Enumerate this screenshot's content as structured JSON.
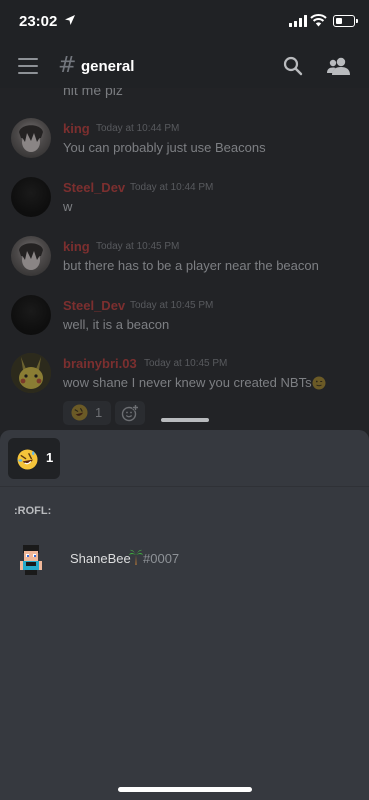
{
  "status_bar": {
    "time": "23:02"
  },
  "header": {
    "channel_hash": "#",
    "channel_name": "general"
  },
  "messages": {
    "previous_partial_text": "hit me plz",
    "items": [
      {
        "author": "king",
        "timestamp": "Today at 10:44 PM",
        "text": "You can probably just use Beacons"
      },
      {
        "author": "Steel_Dev",
        "timestamp": "Today at 10:44 PM",
        "text": "w"
      },
      {
        "author": "king",
        "timestamp": "Today at 10:45 PM",
        "text": "but there has to be a player near the beacon"
      },
      {
        "author": "Steel_Dev",
        "timestamp": "Today at 10:45 PM",
        "text": "well, it is a beacon"
      },
      {
        "author": "brainybri.03",
        "timestamp": "Today at 10:45 PM",
        "text": "wow shane I never knew you created NBTs"
      }
    ],
    "reaction": {
      "emoji": "rofl",
      "count": "1"
    }
  },
  "sheet": {
    "tab": {
      "emoji": "rofl",
      "count": "1"
    },
    "reaction_name": ":ROFL:",
    "users": [
      {
        "name": "ShaneBee",
        "flair": "palm-tree",
        "discriminator": "#0007"
      }
    ]
  }
}
